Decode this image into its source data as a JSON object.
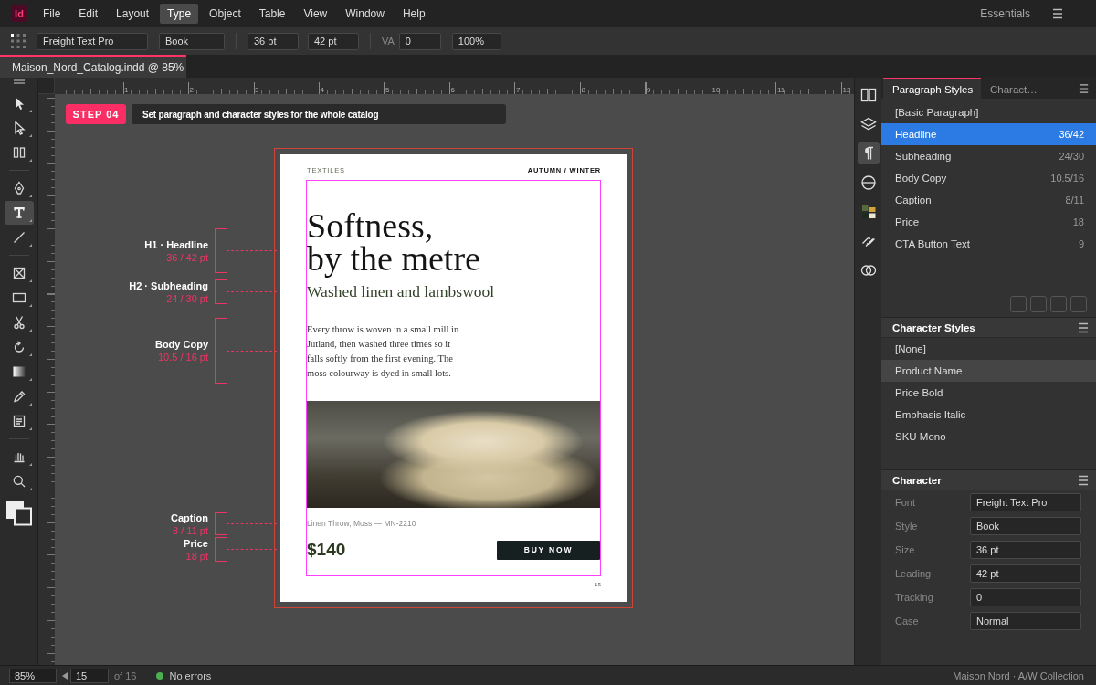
{
  "app": {
    "logo": "Id"
  },
  "menu": [
    {
      "label": "File",
      "selected": false
    },
    {
      "label": "Edit",
      "selected": false
    },
    {
      "label": "Layout",
      "selected": false
    },
    {
      "label": "Type",
      "selected": true
    },
    {
      "label": "Object",
      "selected": false
    },
    {
      "label": "Table",
      "selected": false
    },
    {
      "label": "View",
      "selected": false
    },
    {
      "label": "Window",
      "selected": false
    },
    {
      "label": "Help",
      "selected": false
    }
  ],
  "workspace": {
    "label": "Essentials"
  },
  "control_bar": {
    "groups": [
      [
        {
          "value": "Freight Text Pro"
        },
        {
          "value": "Book"
        }
      ],
      [
        {
          "value": "36 pt"
        },
        {
          "value": "42 pt"
        }
      ],
      [
        {
          "label": "VA",
          "value": "0"
        },
        {
          "value": "100%"
        }
      ]
    ]
  },
  "document_tabs": [
    {
      "title": "Maison_Nord_Catalog.indd @ 85%",
      "selected": true
    }
  ],
  "tools": [
    {
      "selected": false
    },
    {
      "selected": false
    },
    {
      "selected": false
    },
    {
      "selected": false
    },
    {
      "selected": true
    },
    {
      "selected": false
    },
    {
      "selected": false
    },
    {
      "selected": false
    },
    {
      "selected": false
    },
    {
      "selected": false
    },
    {
      "selected": false
    },
    {
      "selected": false
    },
    {
      "selected": false
    },
    {
      "selected": false
    },
    {
      "selected": false
    }
  ],
  "ruler": {
    "marks": [
      "1",
      "2",
      "3",
      "4",
      "5",
      "6",
      "7",
      "8",
      "9",
      "10",
      "11",
      "12"
    ]
  },
  "step": {
    "badge": "STEP 04",
    "instruction": "Set paragraph and character styles for the whole catalog"
  },
  "annotations": [
    {
      "label": "H1 · Headline",
      "value": "36 / 42 pt"
    },
    {
      "label": "H2 · Subheading",
      "value": "24 / 30 pt"
    },
    {
      "label": "Body Copy",
      "value": "10.5 / 16 pt"
    },
    {
      "label": "Caption",
      "value": "8 / 11 pt"
    },
    {
      "label": "Price",
      "value": "18 pt"
    }
  ],
  "page": {
    "header_left": "TEXTILES",
    "header_right": "AUTUMN / WINTER",
    "headline": [
      "Softness,",
      "by the metre"
    ],
    "subheading": "Washed linen and lambswool",
    "body": [
      "Every throw is woven in a small mill in",
      "Jutland, then washed three times so it",
      "falls softly from the first evening. The",
      "moss colourway is dyed in small lots."
    ],
    "caption": "Linen Throw, Moss — MN-2210",
    "price": "$140",
    "cta": "BUY NOW",
    "page_number": "15"
  },
  "panel_icons": [
    {
      "selected": false
    },
    {
      "selected": false
    },
    {
      "selected": true
    },
    {
      "selected": false
    },
    {
      "selected": false
    },
    {
      "selected": false
    },
    {
      "selected": false
    }
  ],
  "paragraph_styles": {
    "tabs": [
      {
        "label": "Paragraph Styles",
        "selected": true
      },
      {
        "label": "Charact…",
        "selected": false
      }
    ],
    "items": [
      {
        "name": "[Basic Paragraph]",
        "selected": false
      },
      {
        "name": "Headline",
        "value": "36/42",
        "selected": true
      },
      {
        "name": "Subheading",
        "value": "24/30",
        "selected": false
      },
      {
        "name": "Body Copy",
        "value": "10.5/16",
        "selected": false
      },
      {
        "name": "Caption",
        "value": "8/11",
        "selected": false
      },
      {
        "name": "Price",
        "value": "18",
        "selected": false
      },
      {
        "name": "CTA Button Text",
        "value": "9",
        "selected": false
      }
    ]
  },
  "character_styles": {
    "title": "Character Styles",
    "items": [
      {
        "name": "[None]",
        "selected": false
      },
      {
        "name": "Product Name",
        "selected": true
      },
      {
        "name": "Price Bold",
        "selected": false
      },
      {
        "name": "Emphasis Italic",
        "selected": false
      },
      {
        "name": "SKU Mono",
        "selected": false
      }
    ]
  },
  "character": {
    "title": "Character",
    "fields": [
      {
        "label": "Font",
        "value": "Freight Text Pro"
      },
      {
        "label": "Style",
        "value": "Book"
      },
      {
        "label": "Size",
        "value": "36 pt"
      },
      {
        "label": "Leading",
        "value": "42 pt"
      },
      {
        "label": "Tracking",
        "value": "0"
      },
      {
        "label": "Case",
        "value": "Normal"
      }
    ]
  },
  "status_bar": {
    "zoom": "85%",
    "page": "15",
    "page_count": "of 16",
    "status": {
      "text": "No errors",
      "ok": true
    },
    "document": "Maison Nord · A/W Collection"
  }
}
